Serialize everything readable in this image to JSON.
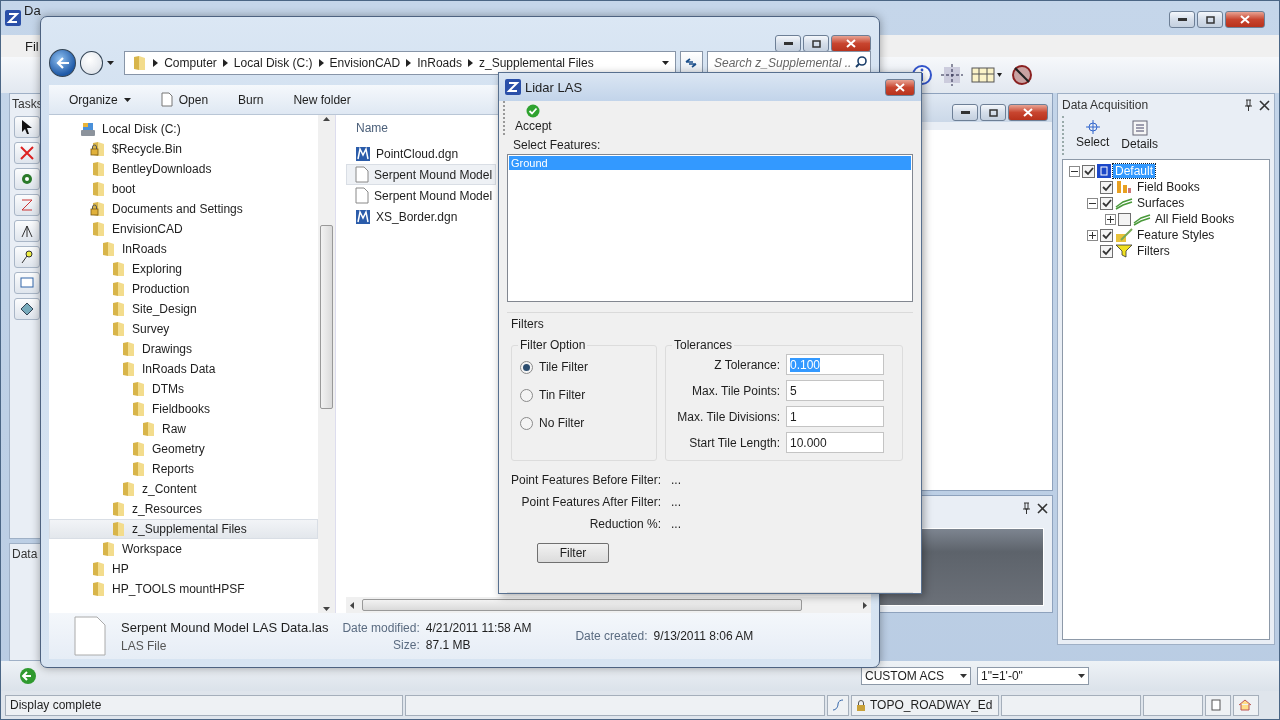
{
  "app_window": {
    "title": "Da",
    "menu": [
      "Fil"
    ],
    "tasks_panel": {
      "title": "Tasks"
    },
    "lower_panel": {
      "title": "Data"
    }
  },
  "explorer": {
    "address": [
      "Computer",
      "Local Disk (C:)",
      "EnvisionCAD",
      "InRoads",
      "z_Supplemental Files"
    ],
    "search": {
      "placeholder": "Search z_Supplemental ..."
    },
    "commands": [
      {
        "label": "Organize",
        "kind": "menu"
      },
      {
        "label": "Open",
        "kind": "file"
      },
      {
        "label": "Burn",
        "kind": "plain"
      },
      {
        "label": "New folder",
        "kind": "plain"
      }
    ],
    "tree": [
      {
        "label": "Local Disk (C:)",
        "kind": "drive",
        "selected": false,
        "children": [
          {
            "label": "$Recycle.Bin",
            "kind": "locked",
            "selected": false
          },
          {
            "label": "BentleyDownloads",
            "kind": "folder",
            "selected": false
          },
          {
            "label": "boot",
            "kind": "folder",
            "selected": false
          },
          {
            "label": "Documents and Settings",
            "kind": "locked",
            "selected": false
          },
          {
            "label": "EnvisionCAD",
            "kind": "folder",
            "selected": false,
            "children": [
              {
                "label": "InRoads",
                "kind": "folder",
                "selected": false,
                "children": [
                  {
                    "label": "Exploring",
                    "kind": "folder",
                    "selected": false
                  },
                  {
                    "label": "Production",
                    "kind": "folder",
                    "selected": false
                  },
                  {
                    "label": "Site_Design",
                    "kind": "folder",
                    "selected": false
                  },
                  {
                    "label": "Survey",
                    "kind": "folder",
                    "selected": false,
                    "children": [
                      {
                        "label": "Drawings",
                        "kind": "folder",
                        "selected": false
                      },
                      {
                        "label": "InRoads Data",
                        "kind": "folder",
                        "selected": false,
                        "children": [
                          {
                            "label": "DTMs",
                            "kind": "folder",
                            "selected": false
                          },
                          {
                            "label": "Fieldbooks",
                            "kind": "folder",
                            "selected": false,
                            "children": [
                              {
                                "label": "Raw",
                                "kind": "folder",
                                "selected": false
                              }
                            ]
                          },
                          {
                            "label": "Geometry",
                            "kind": "folder",
                            "selected": false
                          },
                          {
                            "label": "Reports",
                            "kind": "folder",
                            "selected": false
                          }
                        ]
                      },
                      {
                        "label": "z_Content",
                        "kind": "folder",
                        "selected": false
                      }
                    ]
                  },
                  {
                    "label": "z_Resources",
                    "kind": "folder",
                    "selected": false
                  },
                  {
                    "label": "z_Supplemental Files",
                    "kind": "folder",
                    "selected": true
                  }
                ]
              },
              {
                "label": "Workspace",
                "kind": "folder",
                "selected": false
              }
            ]
          },
          {
            "label": "HP",
            "kind": "folder",
            "selected": false
          },
          {
            "label": "HP_TOOLS mountHPSF",
            "kind": "folder",
            "selected": false
          }
        ]
      }
    ],
    "files": {
      "column": "Name",
      "rows": [
        {
          "name": "PointCloud.dgn",
          "kind": "dgn",
          "hovered": false
        },
        {
          "name": "Serpent Mound Model",
          "kind": "blank",
          "hovered": true
        },
        {
          "name": "Serpent Mound Model",
          "kind": "blank",
          "hovered": false
        },
        {
          "name": "XS_Border.dgn",
          "kind": "dgn",
          "hovered": false
        }
      ]
    },
    "details": {
      "name": "Serpent Mound Model LAS Data.las",
      "type": "LAS File",
      "columns": [
        [
          {
            "label": "Date modified:",
            "value": "4/21/2011 11:58 AM"
          },
          {
            "label": "Size:",
            "value": "87.1 MB"
          }
        ],
        [
          {
            "label": "Date created:",
            "value": "9/13/2011 8:06 AM"
          }
        ]
      ]
    }
  },
  "lidar_dialog": {
    "title": "Lidar LAS",
    "accept": "Accept",
    "features_label": "Select Features:",
    "features": [
      {
        "label": "Ground",
        "selected": true
      }
    ],
    "filters_title": "Filters",
    "filter_option_title": "Filter Option",
    "filter_options": [
      {
        "label": "Tile Filter",
        "selected": true
      },
      {
        "label": "Tin Filter",
        "selected": false
      },
      {
        "label": "No Filter",
        "selected": false
      }
    ],
    "tolerances_title": "Tolerances",
    "tolerances": [
      {
        "label": "Z Tolerance:",
        "value": "0.100",
        "value_selected": true
      },
      {
        "label": "Max. Tile Points:",
        "value": "5",
        "value_selected": false
      },
      {
        "label": "Max. Tile Divisions:",
        "value": "1",
        "value_selected": false
      },
      {
        "label": "Start Tile Length:",
        "value": "10.000",
        "value_selected": false
      }
    ],
    "stats": [
      {
        "label": "Point Features Before Filter:",
        "value": "..."
      },
      {
        "label": "Point Features After Filter:",
        "value": "..."
      },
      {
        "label": "Reduction %:",
        "value": "..."
      }
    ],
    "filter_button": "Filter"
  },
  "data_acquisition": {
    "title": "Data Acquisition",
    "tools": [
      {
        "label": "Select",
        "kind": "select"
      },
      {
        "label": "Details",
        "kind": "details"
      }
    ],
    "tree": [
      {
        "label": "Default",
        "kind": "project",
        "checked": true,
        "selected": true,
        "expanded": true,
        "children": [
          {
            "label": "Field Books",
            "kind": "field-books",
            "checked": true,
            "selected": false
          },
          {
            "label": "Surfaces",
            "kind": "surfaces",
            "checked": true,
            "selected": false,
            "expanded": true,
            "children": [
              {
                "label": "All Field Books",
                "kind": "surface",
                "checked": false,
                "selected": false,
                "expanded": false
              }
            ]
          },
          {
            "label": "Feature Styles",
            "kind": "feature-styles",
            "checked": true,
            "selected": false,
            "expanded": false
          },
          {
            "label": "Filters",
            "kind": "filters",
            "checked": true,
            "selected": false
          }
        ]
      }
    ]
  },
  "bottom_toolbar": {
    "combos": [
      "CUSTOM ACS",
      "1\"=1'-0\""
    ]
  },
  "status_bar": {
    "message": "Display complete",
    "level_name": "TOPO_ROADWAY_Ed"
  }
}
